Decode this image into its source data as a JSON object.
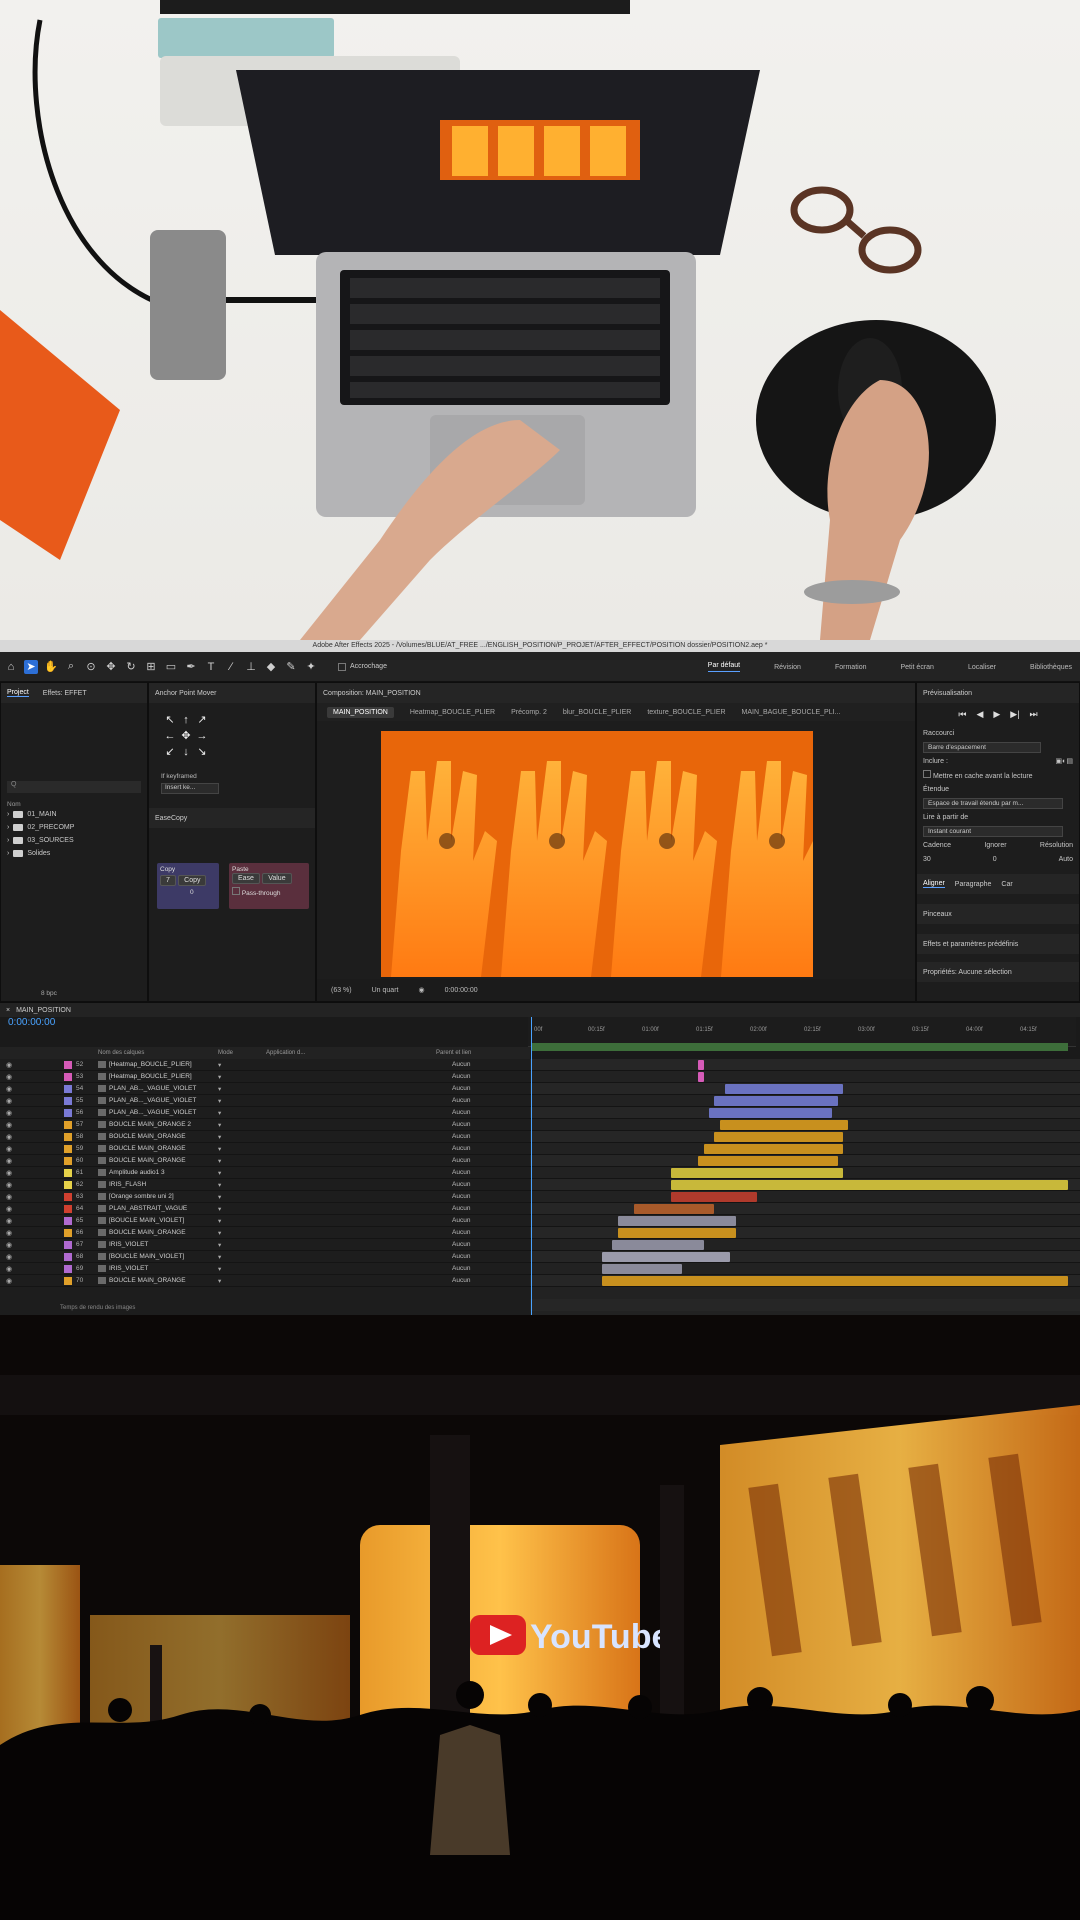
{
  "ae": {
    "window_title": "Adobe After Effects 2025 - /Volumes/BLUE/AT_FREE .../ENGLISH_POSITION/P_PROJET/AFTER_EFFECT/POSITION dossier/POSITION2.aep *",
    "toolbar": {
      "snap_label": "Accrochage",
      "workspaces": [
        "Par défaut",
        "Révision",
        "Formation",
        "Petit écran",
        "Localiser",
        "Bibliothèques"
      ]
    },
    "project_panel": {
      "tabs": [
        "Project",
        "Effets: EFFET"
      ],
      "search_placeholder": "Q",
      "col_name": "Nom",
      "items": [
        "01_MAIN",
        "02_PRECOMP",
        "03_SOURCES",
        "Solides"
      ],
      "footer_bpc": "8 bpc"
    },
    "anchor_panel": {
      "title": "Anchor Point Mover",
      "keyframe_label": "If keyframed",
      "keyframe_value": "Insert ke...",
      "arrows": [
        "↖",
        "↑",
        "↗",
        "←",
        "✥",
        "→",
        "↙",
        "↓",
        "↘"
      ]
    },
    "easecopy": {
      "title": "EaseCopy",
      "copy_label": "Copy",
      "copy_button": "Copy",
      "copy_value": "7",
      "copy_value2": "0",
      "paste_label": "Paste",
      "ease_button": "Ease",
      "value_button": "Value",
      "pass_label": "Pass-through"
    },
    "composition": {
      "header": "Composition: MAIN_POSITION",
      "tabs": [
        "MAIN_POSITION",
        "Heatmap_BOUCLE_PLIER",
        "Précomp. 2",
        "blur_BOUCLE_PLIER",
        "texture_BOUCLE_PLIER",
        "MAIN_BAGUE_BOUCLE_PLI..."
      ],
      "zoom": "(63 %)",
      "quality": "Un quart",
      "timecode": "0:00:00:00"
    },
    "preview_panel": {
      "title": "Prévisualisation",
      "shortcut_label": "Raccourci",
      "shortcut_value": "Barre d'espacement",
      "include_label": "Inclure :",
      "cache_label": "Mettre en cache avant la lecture",
      "range_label": "Étendue",
      "range_value": "Espace de travail étendu par m...",
      "play_from_label": "Lire à partir de",
      "play_from_value": "Instant courant",
      "cadence_label": "Cadence",
      "skip_label": "Ignorer",
      "resolution_label": "Résolution",
      "cadence_value": "30",
      "skip_value": "0",
      "resolution_value": "Auto",
      "sub_tabs": [
        "Aligner",
        "Paragraphe",
        "Car"
      ],
      "section1": "Pinceaux",
      "section2": "Effets et paramètres prédéfinis",
      "section3": "Propriétés: Aucune sélection"
    },
    "timeline": {
      "comp_name": "MAIN_POSITION",
      "current_time": "0:00:00:00",
      "col_layer": "Nom des calques",
      "col_mode": "Mode",
      "col_apply": "Application d...",
      "col_parent": "Parent et lien",
      "ruler_ticks": [
        "00f",
        "00:15f",
        "01:00f",
        "01:15f",
        "02:00f",
        "02:15f",
        "03:00f",
        "03:15f",
        "04:00f",
        "04:15f"
      ],
      "footer": "Temps de rendu des images",
      "layers": [
        {
          "num": "52",
          "name": "[Heatmap_BOUCLE_PLIER]",
          "color": "#d65bb8",
          "parent": "Aucun"
        },
        {
          "num": "53",
          "name": "[Heatmap_BOUCLE_PLIER]",
          "color": "#d65bb8",
          "parent": "Aucun"
        },
        {
          "num": "54",
          "name": "PLAN_AB..._VAGUE_VIOLET",
          "color": "#7a7ad6",
          "parent": "Aucun"
        },
        {
          "num": "55",
          "name": "PLAN_AB..._VAGUE_VIOLET",
          "color": "#7a7ad6",
          "parent": "Aucun"
        },
        {
          "num": "56",
          "name": "PLAN_AB..._VAGUE_VIOLET",
          "color": "#7a7ad6",
          "parent": "Aucun"
        },
        {
          "num": "57",
          "name": "BOUCLE MAIN_ORANGE 2",
          "color": "#e0a02a",
          "parent": "Aucun"
        },
        {
          "num": "58",
          "name": "BOUCLE MAIN_ORANGE",
          "color": "#e0a02a",
          "parent": "Aucun"
        },
        {
          "num": "59",
          "name": "BOUCLE MAIN_ORANGE",
          "color": "#e0a02a",
          "parent": "Aucun"
        },
        {
          "num": "60",
          "name": "BOUCLE MAIN_ORANGE",
          "color": "#e0a02a",
          "parent": "Aucun"
        },
        {
          "num": "61",
          "name": "Amplitude audio1 3",
          "color": "#e6d24a",
          "parent": "Aucun"
        },
        {
          "num": "62",
          "name": "IRIS_FLASH",
          "color": "#e6d24a",
          "parent": "Aucun"
        },
        {
          "num": "63",
          "name": "[Orange sombre uni 2]",
          "color": "#d04030",
          "parent": "Aucun"
        },
        {
          "num": "64",
          "name": "PLAN_ABSTRAIT_VAGUE",
          "color": "#d04030",
          "parent": "Aucun"
        },
        {
          "num": "65",
          "name": "[BOUCLE MAIN_VIOLET]",
          "color": "#b06ad0",
          "parent": "Aucun"
        },
        {
          "num": "66",
          "name": "BOUCLE MAIN_ORANGE",
          "color": "#e0a02a",
          "parent": "Aucun"
        },
        {
          "num": "67",
          "name": "IRIS_VIOLET",
          "color": "#b06ad0",
          "parent": "Aucun"
        },
        {
          "num": "68",
          "name": "[BOUCLE MAIN_VIOLET]",
          "color": "#b06ad0",
          "parent": "Aucun"
        },
        {
          "num": "69",
          "name": "IRIS_VIOLET",
          "color": "#b06ad0",
          "parent": "Aucun"
        },
        {
          "num": "70",
          "name": "BOUCLE MAIN_ORANGE",
          "color": "#e0a02a",
          "parent": "Aucun"
        }
      ],
      "bars": [
        {
          "start": 0.31,
          "end": 0.32,
          "color": "#d65bb8"
        },
        {
          "start": 0.31,
          "end": 0.32,
          "color": "#d65bb8"
        },
        {
          "start": 0.36,
          "end": 0.58,
          "color": "#6a72c0"
        },
        {
          "start": 0.34,
          "end": 0.57,
          "color": "#6a72c0"
        },
        {
          "start": 0.33,
          "end": 0.56,
          "color": "#6a72c0"
        },
        {
          "start": 0.35,
          "end": 0.59,
          "color": "#c8901e"
        },
        {
          "start": 0.34,
          "end": 0.58,
          "color": "#c8901e"
        },
        {
          "start": 0.32,
          "end": 0.58,
          "color": "#c8901e"
        },
        {
          "start": 0.31,
          "end": 0.57,
          "color": "#c8901e"
        },
        {
          "start": 0.26,
          "end": 0.58,
          "color": "#c8b83a"
        },
        {
          "start": 0.26,
          "end": 1.0,
          "color": "#c8b83a"
        },
        {
          "start": 0.26,
          "end": 0.42,
          "color": "#b03a2c"
        },
        {
          "start": 0.19,
          "end": 0.34,
          "color": "#a85a2a"
        },
        {
          "start": 0.16,
          "end": 0.38,
          "color": "#8a8a9a"
        },
        {
          "start": 0.16,
          "end": 0.38,
          "color": "#c8901e"
        },
        {
          "start": 0.15,
          "end": 0.32,
          "color": "#8a8a9a"
        },
        {
          "start": 0.13,
          "end": 0.37,
          "color": "#9a9aaa"
        },
        {
          "start": 0.13,
          "end": 0.28,
          "color": "#8a8a9a"
        },
        {
          "start": 0.13,
          "end": 1.0,
          "color": "#c8901e"
        }
      ]
    }
  },
  "bottom_photo": {
    "screen_text": "YouTube"
  },
  "colors": {
    "accent": "#2d6fd6",
    "orange": "#e8660a",
    "timecode": "#4aa3ff"
  }
}
